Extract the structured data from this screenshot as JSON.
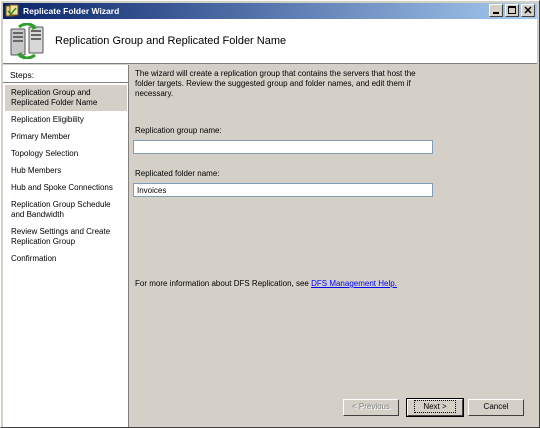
{
  "window": {
    "title": "Replicate Folder Wizard"
  },
  "caption_buttons": {
    "minimize": "_",
    "maximize": "□",
    "close": "×"
  },
  "header": {
    "title": "Replication Group and Replicated Folder Name"
  },
  "steps": {
    "heading": "Steps:",
    "items": [
      {
        "label": "Replication Group and Replicated Folder Name",
        "active": true
      },
      {
        "label": "Replication Eligibility",
        "active": false
      },
      {
        "label": "Primary Member",
        "active": false
      },
      {
        "label": "Topology Selection",
        "active": false
      },
      {
        "label": "Hub Members",
        "active": false
      },
      {
        "label": "Hub and Spoke Connections",
        "active": false
      },
      {
        "label": "Replication Group Schedule and Bandwidth",
        "active": false
      },
      {
        "label": "Review Settings and Create Replication Group",
        "active": false
      },
      {
        "label": "Confirmation",
        "active": false
      }
    ]
  },
  "main": {
    "description": "The wizard will create a replication group that contains the servers that host the folder targets. Review the suggested group and folder names, and edit them if necessary.",
    "group_name_label": "Replication group name:",
    "group_name_value": "",
    "folder_name_label": "Replicated folder name:",
    "folder_name_value": "Invoices",
    "more_info_text": "For more information about DFS Replication, see",
    "more_info_link": "DFS Management Help."
  },
  "buttons": {
    "previous": "< Previous",
    "next": "Next >",
    "cancel": "Cancel"
  },
  "colors": {
    "titlebar_start": "#0a246a",
    "titlebar_end": "#a6caf0",
    "link": "#0000ff"
  }
}
